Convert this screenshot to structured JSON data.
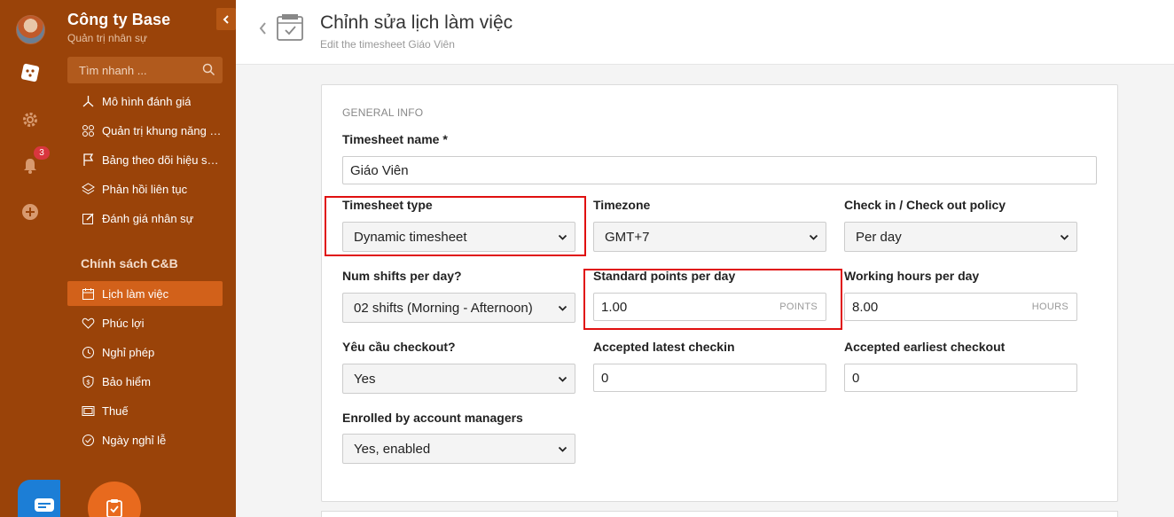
{
  "sidebar": {
    "company_name": "Công ty Base",
    "company_subtitle": "Quản trị nhân sự",
    "search_placeholder": "Tìm nhanh ...",
    "notification_count": "3",
    "items": [
      {
        "label": "Mô hình đánh giá",
        "icon": "model-icon"
      },
      {
        "label": "Quản trị khung năng lực",
        "icon": "grid-icon"
      },
      {
        "label": "Bảng theo dõi hiệu suất",
        "icon": "flag-icon"
      },
      {
        "label": "Phản hồi liên tục",
        "icon": "layers-icon"
      },
      {
        "label": "Đánh giá nhân sự",
        "icon": "edit-icon"
      }
    ],
    "section_title": "Chính sách C&B",
    "section_items": [
      {
        "label": "Lịch làm việc",
        "icon": "calendar-icon",
        "active": true
      },
      {
        "label": "Phúc lợi",
        "icon": "heart-icon"
      },
      {
        "label": "Nghỉ phép",
        "icon": "clock-icon"
      },
      {
        "label": "Bảo hiểm",
        "icon": "shield-dollar-icon"
      },
      {
        "label": "Thuế",
        "icon": "receipt-icon"
      },
      {
        "label": "Ngày nghỉ lễ",
        "icon": "check-circle-icon"
      }
    ]
  },
  "header": {
    "title": "Chỉnh sửa lịch làm việc",
    "subtitle": "Edit the timesheet Giáo Viên"
  },
  "form": {
    "section_label": "GENERAL INFO",
    "timesheet_name": {
      "label": "Timesheet name *",
      "value": "Giáo Viên"
    },
    "timesheet_type": {
      "label": "Timesheet type",
      "value": "Dynamic timesheet"
    },
    "timezone": {
      "label": "Timezone",
      "value": "GMT+7"
    },
    "checkin_policy": {
      "label": "Check in / Check out policy",
      "value": "Per day"
    },
    "num_shifts": {
      "label": "Num shifts per day?",
      "value": "02 shifts (Morning - Afternoon)"
    },
    "standard_points": {
      "label": "Standard points per day",
      "value": "1.00",
      "unit": "POINTS"
    },
    "working_hours": {
      "label": "Working hours per day",
      "value": "8.00",
      "unit": "HOURS"
    },
    "require_checkout": {
      "label": "Yêu cầu checkout?",
      "value": "Yes"
    },
    "latest_checkin": {
      "label": "Accepted latest checkin",
      "value": "0"
    },
    "earliest_checkout": {
      "label": "Accepted earliest checkout",
      "value": "0"
    },
    "enrolled_managers": {
      "label": "Enrolled by account managers",
      "value": "Yes, enabled"
    }
  },
  "colors": {
    "sidebar_bg": "#9a4309",
    "active_item": "#d2611a",
    "highlight": "#e01010",
    "badge": "#d9363e"
  }
}
